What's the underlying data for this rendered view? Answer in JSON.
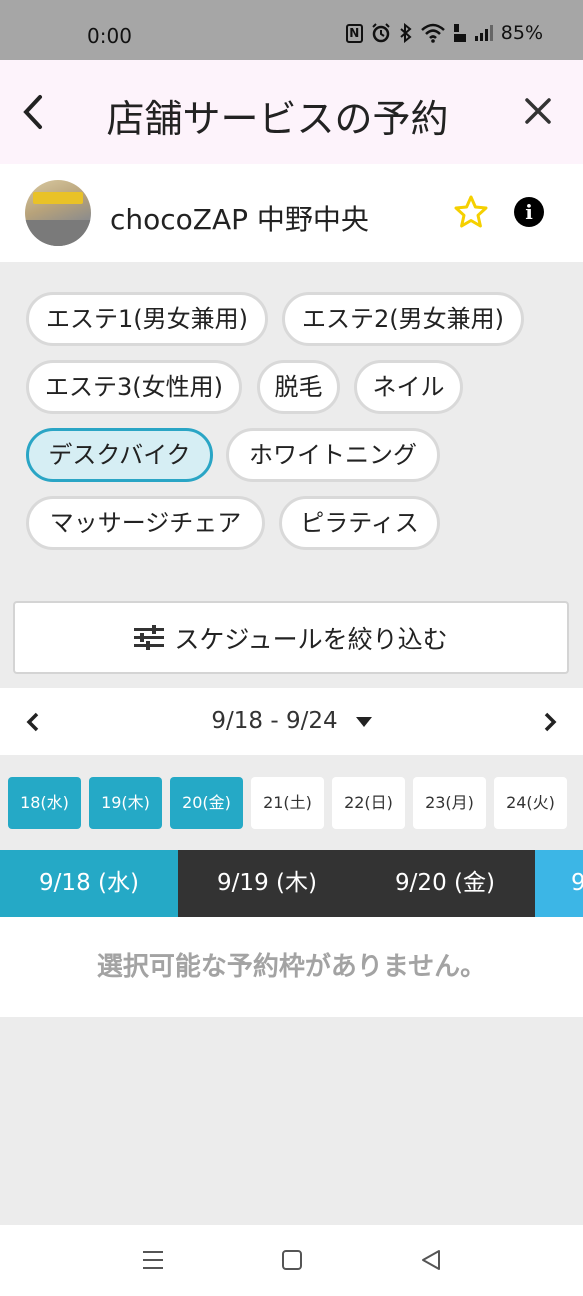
{
  "status_bar": {
    "time": "0:00",
    "battery": "85%",
    "icons": [
      "nfc-icon",
      "alarm-icon",
      "bluetooth-icon",
      "wifi-icon",
      "volte-icon",
      "signal-icon"
    ],
    "nfc_text": "N"
  },
  "header": {
    "title": "店舗サービスの予約",
    "back_icon": "chevron-left-icon",
    "close_icon": "close-icon"
  },
  "store": {
    "name": "chocoZAP 中野中央",
    "favorite_icon": "star-outline-icon",
    "info_icon": "info-icon",
    "info_glyph": "i",
    "favorite_color": "#f5d000"
  },
  "services": [
    {
      "label": "エステ1(男女兼用)",
      "selected": false
    },
    {
      "label": "エステ2(男女兼用)",
      "selected": false
    },
    {
      "label": "エステ3(女性用)",
      "selected": false
    },
    {
      "label": "脱毛",
      "selected": false
    },
    {
      "label": "ネイル",
      "selected": false
    },
    {
      "label": "デスクバイク",
      "selected": true
    },
    {
      "label": "ホワイトニング",
      "selected": false
    },
    {
      "label": "マッサージチェア",
      "selected": false
    },
    {
      "label": "ピラティス",
      "selected": false
    }
  ],
  "filter": {
    "label": "スケジュールを絞り込む",
    "icon": "sliders-icon"
  },
  "week": {
    "range": "9/18 - 9/24",
    "prev_icon": "chevron-left-icon",
    "next_icon": "chevron-right-icon",
    "dropdown_icon": "caret-down-icon"
  },
  "days": [
    {
      "label": "18(水)",
      "active": true
    },
    {
      "label": "19(木)",
      "active": true
    },
    {
      "label": "20(金)",
      "active": true
    },
    {
      "label": "21(土)",
      "active": false
    },
    {
      "label": "22(日)",
      "active": false
    },
    {
      "label": "23(月)",
      "active": false
    },
    {
      "label": "24(火)",
      "active": false
    }
  ],
  "date_tabs": [
    {
      "label": "9/18 (水)",
      "active": true
    },
    {
      "label": "9/19 (木)",
      "active": false
    },
    {
      "label": "9/20 (金)",
      "active": false
    },
    {
      "label": "9",
      "active": false
    }
  ],
  "empty_message": "選択可能な予約枠がありません。",
  "accent_color": "#25a9c6",
  "nav_bar": {
    "icons": [
      "recents-icon",
      "home-icon",
      "back-icon"
    ]
  }
}
